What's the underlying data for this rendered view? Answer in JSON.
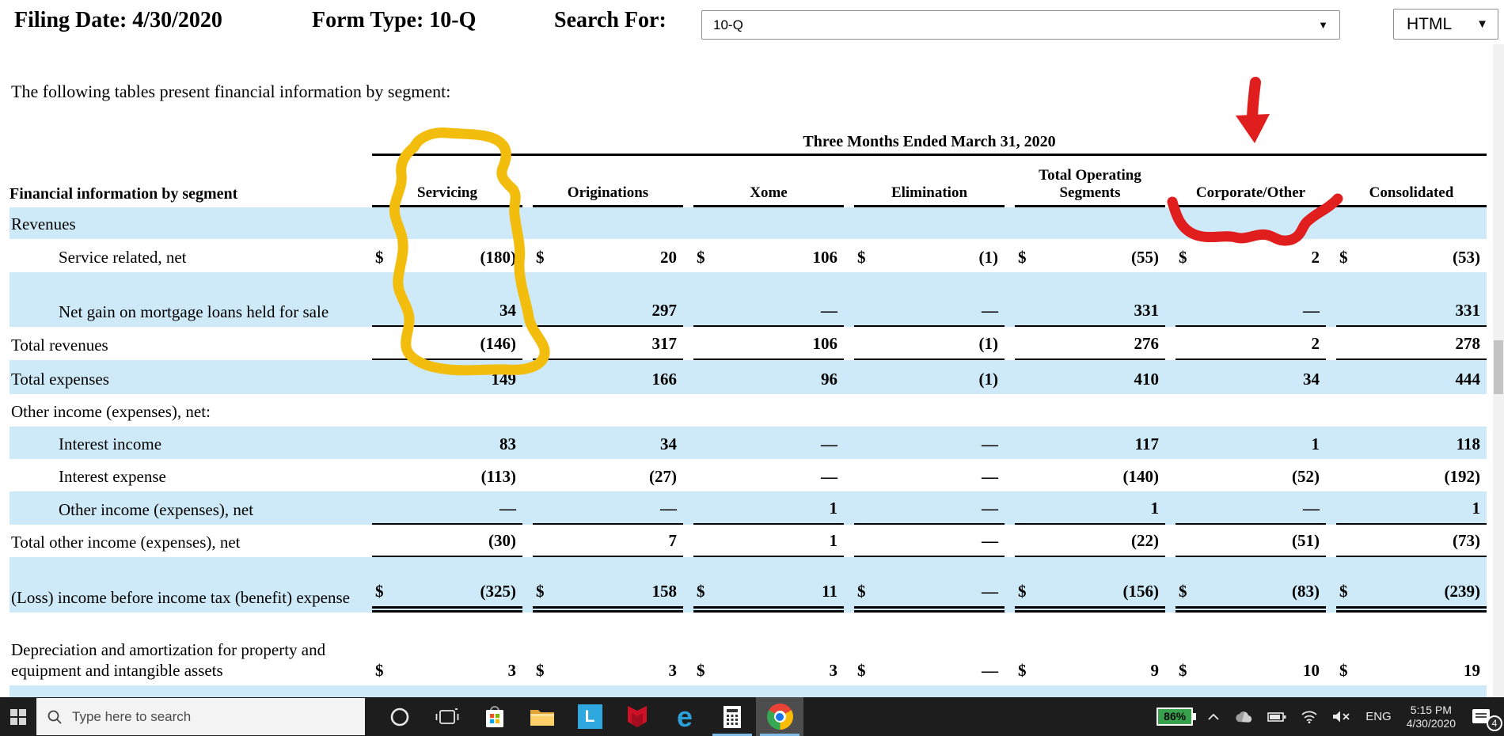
{
  "header": {
    "filing_date": "Filing Date: 4/30/2020",
    "form_type": "Form Type: 10-Q",
    "search_label": "Search For:",
    "search_value": "10-Q",
    "format_value": "HTML"
  },
  "icons": {
    "dropdown_arrow": "▼"
  },
  "intro": "The following tables present financial information by segment:",
  "table": {
    "period_header": "Three Months Ended March 31, 2020",
    "row_header": "Financial information by segment",
    "columns": [
      "Servicing",
      "Originations",
      "Xome",
      "Elimination",
      "Total Operating Segments",
      "Corporate/Other",
      "Consolidated"
    ],
    "rows": [
      {
        "label": "Revenues",
        "indent": 0,
        "shaded": true,
        "values": null
      },
      {
        "label": "Service related, net",
        "indent": 1,
        "shaded": false,
        "dollar": true,
        "values": [
          "(180)",
          "20",
          "106",
          "(1)",
          "(55)",
          "2",
          "(53)"
        ]
      },
      {
        "label": "Net gain on mortgage loans held for sale",
        "indent": 1,
        "shaded": true,
        "values": [
          "34",
          "297",
          "—",
          "—",
          "331",
          "—",
          "331"
        ],
        "rule_below": "single"
      },
      {
        "label": "Total revenues",
        "indent": 0,
        "shaded": false,
        "values": [
          "(146)",
          "317",
          "106",
          "(1)",
          "276",
          "2",
          "278"
        ],
        "rule_below": "single"
      },
      {
        "label": "Total expenses",
        "indent": 0,
        "shaded": true,
        "values": [
          "149",
          "166",
          "96",
          "(1)",
          "410",
          "34",
          "444"
        ]
      },
      {
        "label": "Other income (expenses), net:",
        "indent": 0,
        "shaded": false,
        "values": null
      },
      {
        "label": "Interest income",
        "indent": 1,
        "shaded": true,
        "values": [
          "83",
          "34",
          "—",
          "—",
          "117",
          "1",
          "118"
        ]
      },
      {
        "label": "Interest expense",
        "indent": 1,
        "shaded": false,
        "values": [
          "(113)",
          "(27)",
          "—",
          "—",
          "(140)",
          "(52)",
          "(192)"
        ]
      },
      {
        "label": "Other income (expenses), net",
        "indent": 1,
        "shaded": true,
        "values": [
          "—",
          "—",
          "1",
          "—",
          "1",
          "—",
          "1"
        ],
        "rule_below": "single"
      },
      {
        "label": "Total other income (expenses), net",
        "indent": 0,
        "shaded": false,
        "values": [
          "(30)",
          "7",
          "1",
          "—",
          "(22)",
          "(51)",
          "(73)"
        ],
        "rule_below": "single"
      },
      {
        "label": "(Loss) income before income tax (benefit) expense",
        "indent": 0,
        "shaded": true,
        "dollar": true,
        "values": [
          "(325)",
          "158",
          "11",
          "—",
          "(156)",
          "(83)",
          "(239)"
        ],
        "rule_below": "double"
      },
      {
        "label": "Depreciation and amortization for property and equipment and intangible assets",
        "indent": 0,
        "shaded": false,
        "dollar": true,
        "values": [
          "3",
          "3",
          "3",
          "—",
          "9",
          "10",
          "19"
        ]
      },
      {
        "label": "",
        "indent": 0,
        "shaded": true,
        "values": null
      }
    ]
  },
  "annotations": {
    "highlight_color": "#F2BD0D",
    "marker_color": "#E01E1E",
    "circled_column": "Servicing",
    "arrow_target_column": "Corporate/Other"
  },
  "taskbar": {
    "search_placeholder": "Type here to search",
    "pinned_apps": [
      "cortana",
      "task-view",
      "microsoft-store",
      "file-explorer",
      "lenovo-app",
      "mcafee",
      "edge",
      "calculator",
      "chrome"
    ],
    "battery_percent": "86%",
    "language": "ENG",
    "time": "5:15 PM",
    "date": "4/30/2020",
    "notification_count": "4"
  }
}
